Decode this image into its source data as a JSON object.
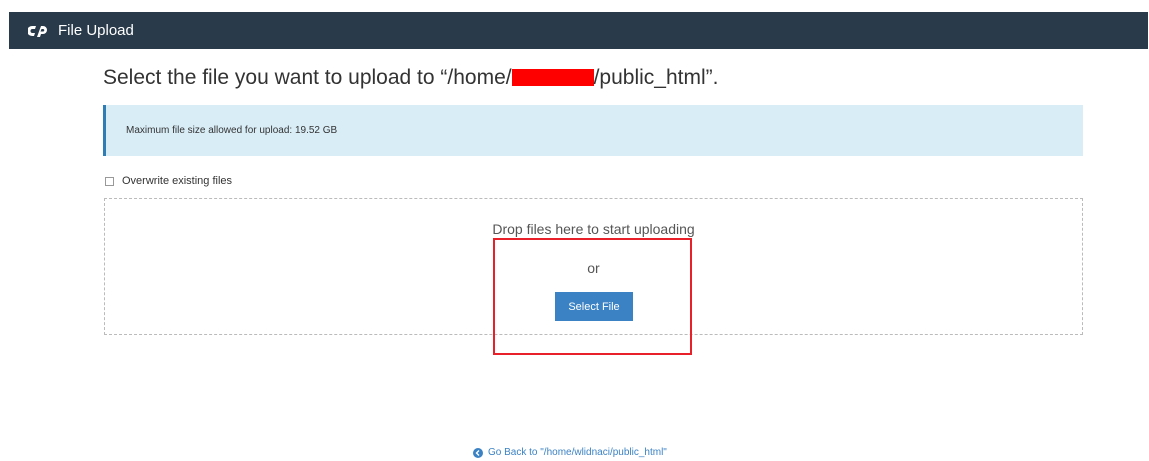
{
  "header": {
    "logo_icon": "cpanel-logo",
    "title": "File Upload"
  },
  "heading": {
    "prefix": "Select the file you want to upload to “/home/",
    "suffix": "/public_html”."
  },
  "info": {
    "text": "Maximum file size allowed for upload: 19.52 GB"
  },
  "overwrite": {
    "label": "Overwrite existing files",
    "checked": false
  },
  "dropzone": {
    "drop_text": "Drop files here to start uploading",
    "or_text": "or",
    "button_label": "Select File"
  },
  "footer": {
    "back_icon": "circle-arrow-left-icon",
    "back_link": "Go Back to \"/home/wlidnaci/public_html\""
  },
  "colors": {
    "topbar": "#293a4a",
    "info_bg": "#d9edf7",
    "button": "#3b82c4",
    "annotation": "#e8202a",
    "redaction": "#ff0000"
  }
}
